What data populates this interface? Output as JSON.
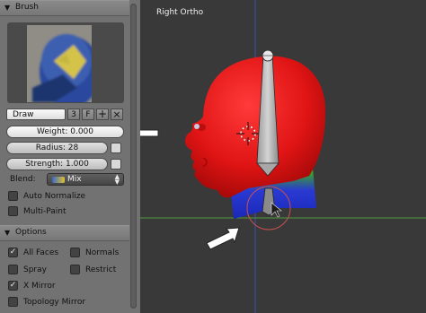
{
  "brush_panel": {
    "title": "Brush",
    "brush_name": "Draw",
    "brush_users": "3",
    "fake_user": "F",
    "add_icon": "plus-icon",
    "remove_icon": "x-icon",
    "weight": "Weight: 0.000",
    "radius": "Radius: 28",
    "strength": "Strength: 1.000",
    "blend_label": "Blend:",
    "blend_value": "Mix",
    "auto_normalize": {
      "label": "Auto Normalize",
      "checked": false
    },
    "multi_paint": {
      "label": "Multi-Paint",
      "checked": false
    }
  },
  "options_panel": {
    "title": "Options",
    "all_faces": {
      "label": "All Faces",
      "checked": true
    },
    "normals": {
      "label": "Normals",
      "checked": false
    },
    "spray": {
      "label": "Spray",
      "checked": false
    },
    "restrict": {
      "label": "Restrict",
      "checked": false
    },
    "x_mirror": {
      "label": "X Mirror",
      "checked": true
    },
    "topology_mirror": {
      "label": "Topology Mirror",
      "checked": false
    }
  },
  "viewport": {
    "label": "Right Ortho"
  },
  "colors": {
    "panel_bg": "#727272",
    "viewport_bg": "#393939",
    "axis_blue": "#3a4fb4",
    "axis_green": "#4f9a3f",
    "head_red": "#e41616"
  }
}
